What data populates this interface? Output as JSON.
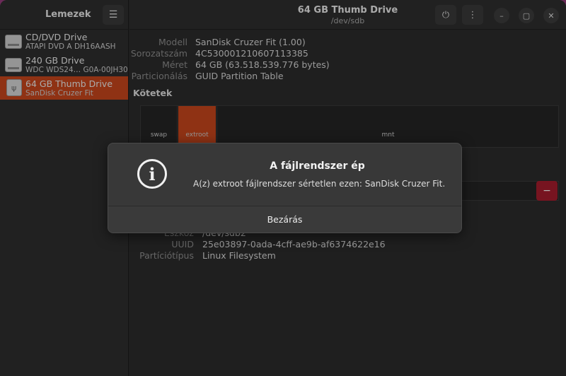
{
  "sidebar": {
    "title": "Lemezek",
    "menu_icon": "hamburger-menu-icon",
    "drives": [
      {
        "name": "CD/DVD Drive",
        "sub": "ATAPI   DVD A   DH16AASH",
        "icon": "optical-drive-icon"
      },
      {
        "name": "240 GB Drive",
        "sub": "WDC WDS24…  G0A-00JH30",
        "icon": "hard-drive-icon"
      },
      {
        "name": "64 GB Thumb Drive",
        "sub": "SanDisk Cruzer Fit",
        "icon": "usb-drive-icon"
      }
    ]
  },
  "header": {
    "title": "64 GB Thumb Drive",
    "subtitle": "/dev/sdb",
    "power_icon": "power-icon",
    "more_icon": "more-vertical-icon",
    "minimize_icon": "minimize-icon",
    "maximize_icon": "maximize-icon",
    "close_icon": "close-icon"
  },
  "info": [
    {
      "label": "Modell",
      "value": "SanDisk Cruzer Fit (1.00)"
    },
    {
      "label": "Sorozatszám",
      "value": "4C530001210607113385"
    },
    {
      "label": "Méret",
      "value": "64 GB (63.518.539.776 bytes)"
    },
    {
      "label": "Particionálás",
      "value": "GUID Partition Table"
    }
  ],
  "volumes_title": "Kötetek",
  "volumes": [
    {
      "name": "swap"
    },
    {
      "name": "extroot"
    },
    {
      "name": "mnt"
    }
  ],
  "delete_button": "−",
  "details": [
    {
      "label": "Eszköz",
      "value": "/dev/sdb2"
    },
    {
      "label": "UUID",
      "value": "25e03897-0ada-4cff-ae9b-af6374622e16"
    },
    {
      "label": "Partíciótípus",
      "value": "Linux Filesystem"
    }
  ],
  "dialog": {
    "icon": "info-icon",
    "title": "A fájlrendszer ép",
    "message": "A(z) extroot fájlrendszer sértetlen ezen: SanDisk Cruzer Fit.",
    "button": "Bezárás"
  },
  "colors": {
    "accent": "#c7461d",
    "danger": "#a51d2d",
    "desktop": "#6b2a58"
  }
}
